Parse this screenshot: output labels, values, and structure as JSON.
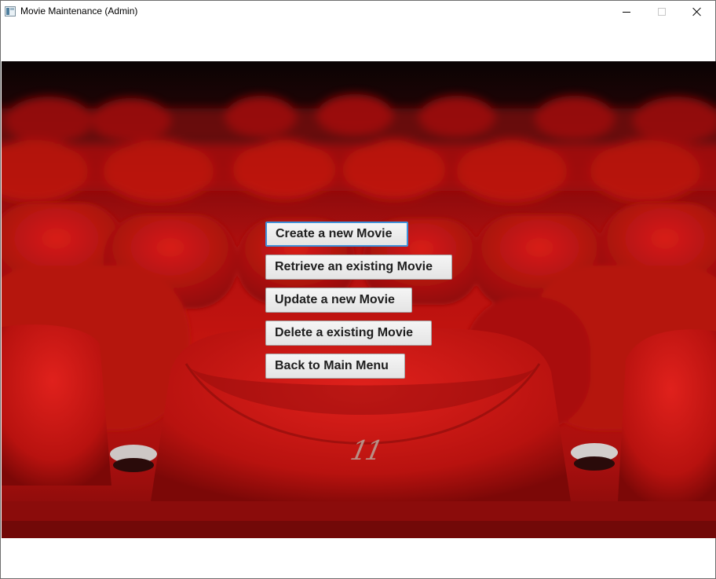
{
  "window": {
    "title": "Movie Maintenance (Admin)",
    "icon": "java-window-icon"
  },
  "title_controls": [
    "minimize-icon",
    "maximize-icon",
    "close-icon"
  ],
  "background": {
    "seat_number": "11"
  },
  "menu": {
    "create_label": "Create a new Movie",
    "retrieve_label": "Retrieve an existing Movie",
    "update_label": "Update a new Movie",
    "delete_label": "Delete a existing Movie",
    "back_label": "Back to Main Menu",
    "focused": "create"
  },
  "colors": {
    "focus_border": "#3f91d9",
    "seat_red": "#c4140f"
  }
}
